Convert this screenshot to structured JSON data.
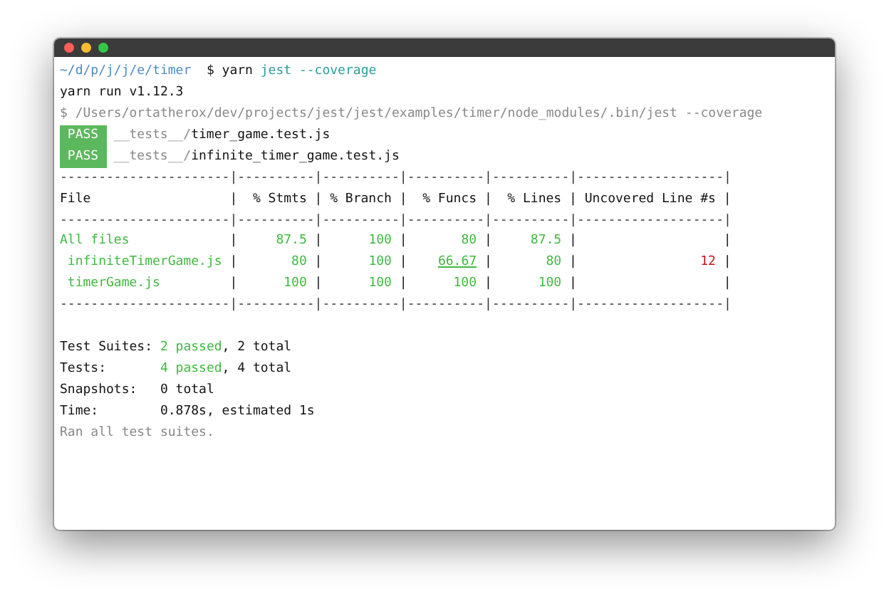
{
  "window": {
    "buttons": [
      {
        "color": "#fc5f57"
      },
      {
        "color": "#fdbc2e"
      },
      {
        "color": "#33c748"
      }
    ]
  },
  "prompt": {
    "path": "~/d/p/j/j/e/timer",
    "symbol": "$",
    "command": "yarn",
    "args": "jest --coverage"
  },
  "yarn_version": "yarn run v1.12.3",
  "run_command": "$ /Users/ortatherox/dev/projects/jest/jest/examples/timer/node_modules/.bin/jest --coverage",
  "results": [
    {
      "status": "PASS",
      "dir": "__tests__/",
      "file": "timer_game.test.js"
    },
    {
      "status": "PASS",
      "dir": "__tests__/",
      "file": "infinite_timer_game.test.js"
    }
  ],
  "coverage": {
    "divider": "|",
    "separator": "----------------------|----------|----------|----------|----------|-------------------|",
    "columns": [
      "File",
      "% Stmts",
      "% Branch",
      "% Funcs",
      "% Lines",
      "Uncovered Line #s"
    ],
    "rows": [
      {
        "file": "All files",
        "stmts": "87.5",
        "branch": "100",
        "funcs": "80",
        "lines": "87.5",
        "children": [
          {
            "file": "infiniteTimerGame.js",
            "stmts": "80",
            "branch": "100",
            "funcs": "66.67",
            "funcs_underlined": true,
            "lines": "80",
            "uncovered": "12"
          },
          {
            "file": "timerGame.js",
            "stmts": "100",
            "branch": "100",
            "funcs": "100",
            "funcs_underlined": false,
            "lines": "100"
          }
        ]
      }
    ]
  },
  "summary": [
    {
      "label": "Test Suites:",
      "passed": "2 passed",
      "rest": ", 2 total"
    },
    {
      "label": "Tests:",
      "passed": "4 passed",
      "rest": ", 4 total"
    },
    {
      "label": "Snapshots:",
      "rest": "0 total"
    },
    {
      "label": "Time:",
      "rest": "0.878s, estimated 1s"
    }
  ],
  "footer": "Ran all test suites."
}
